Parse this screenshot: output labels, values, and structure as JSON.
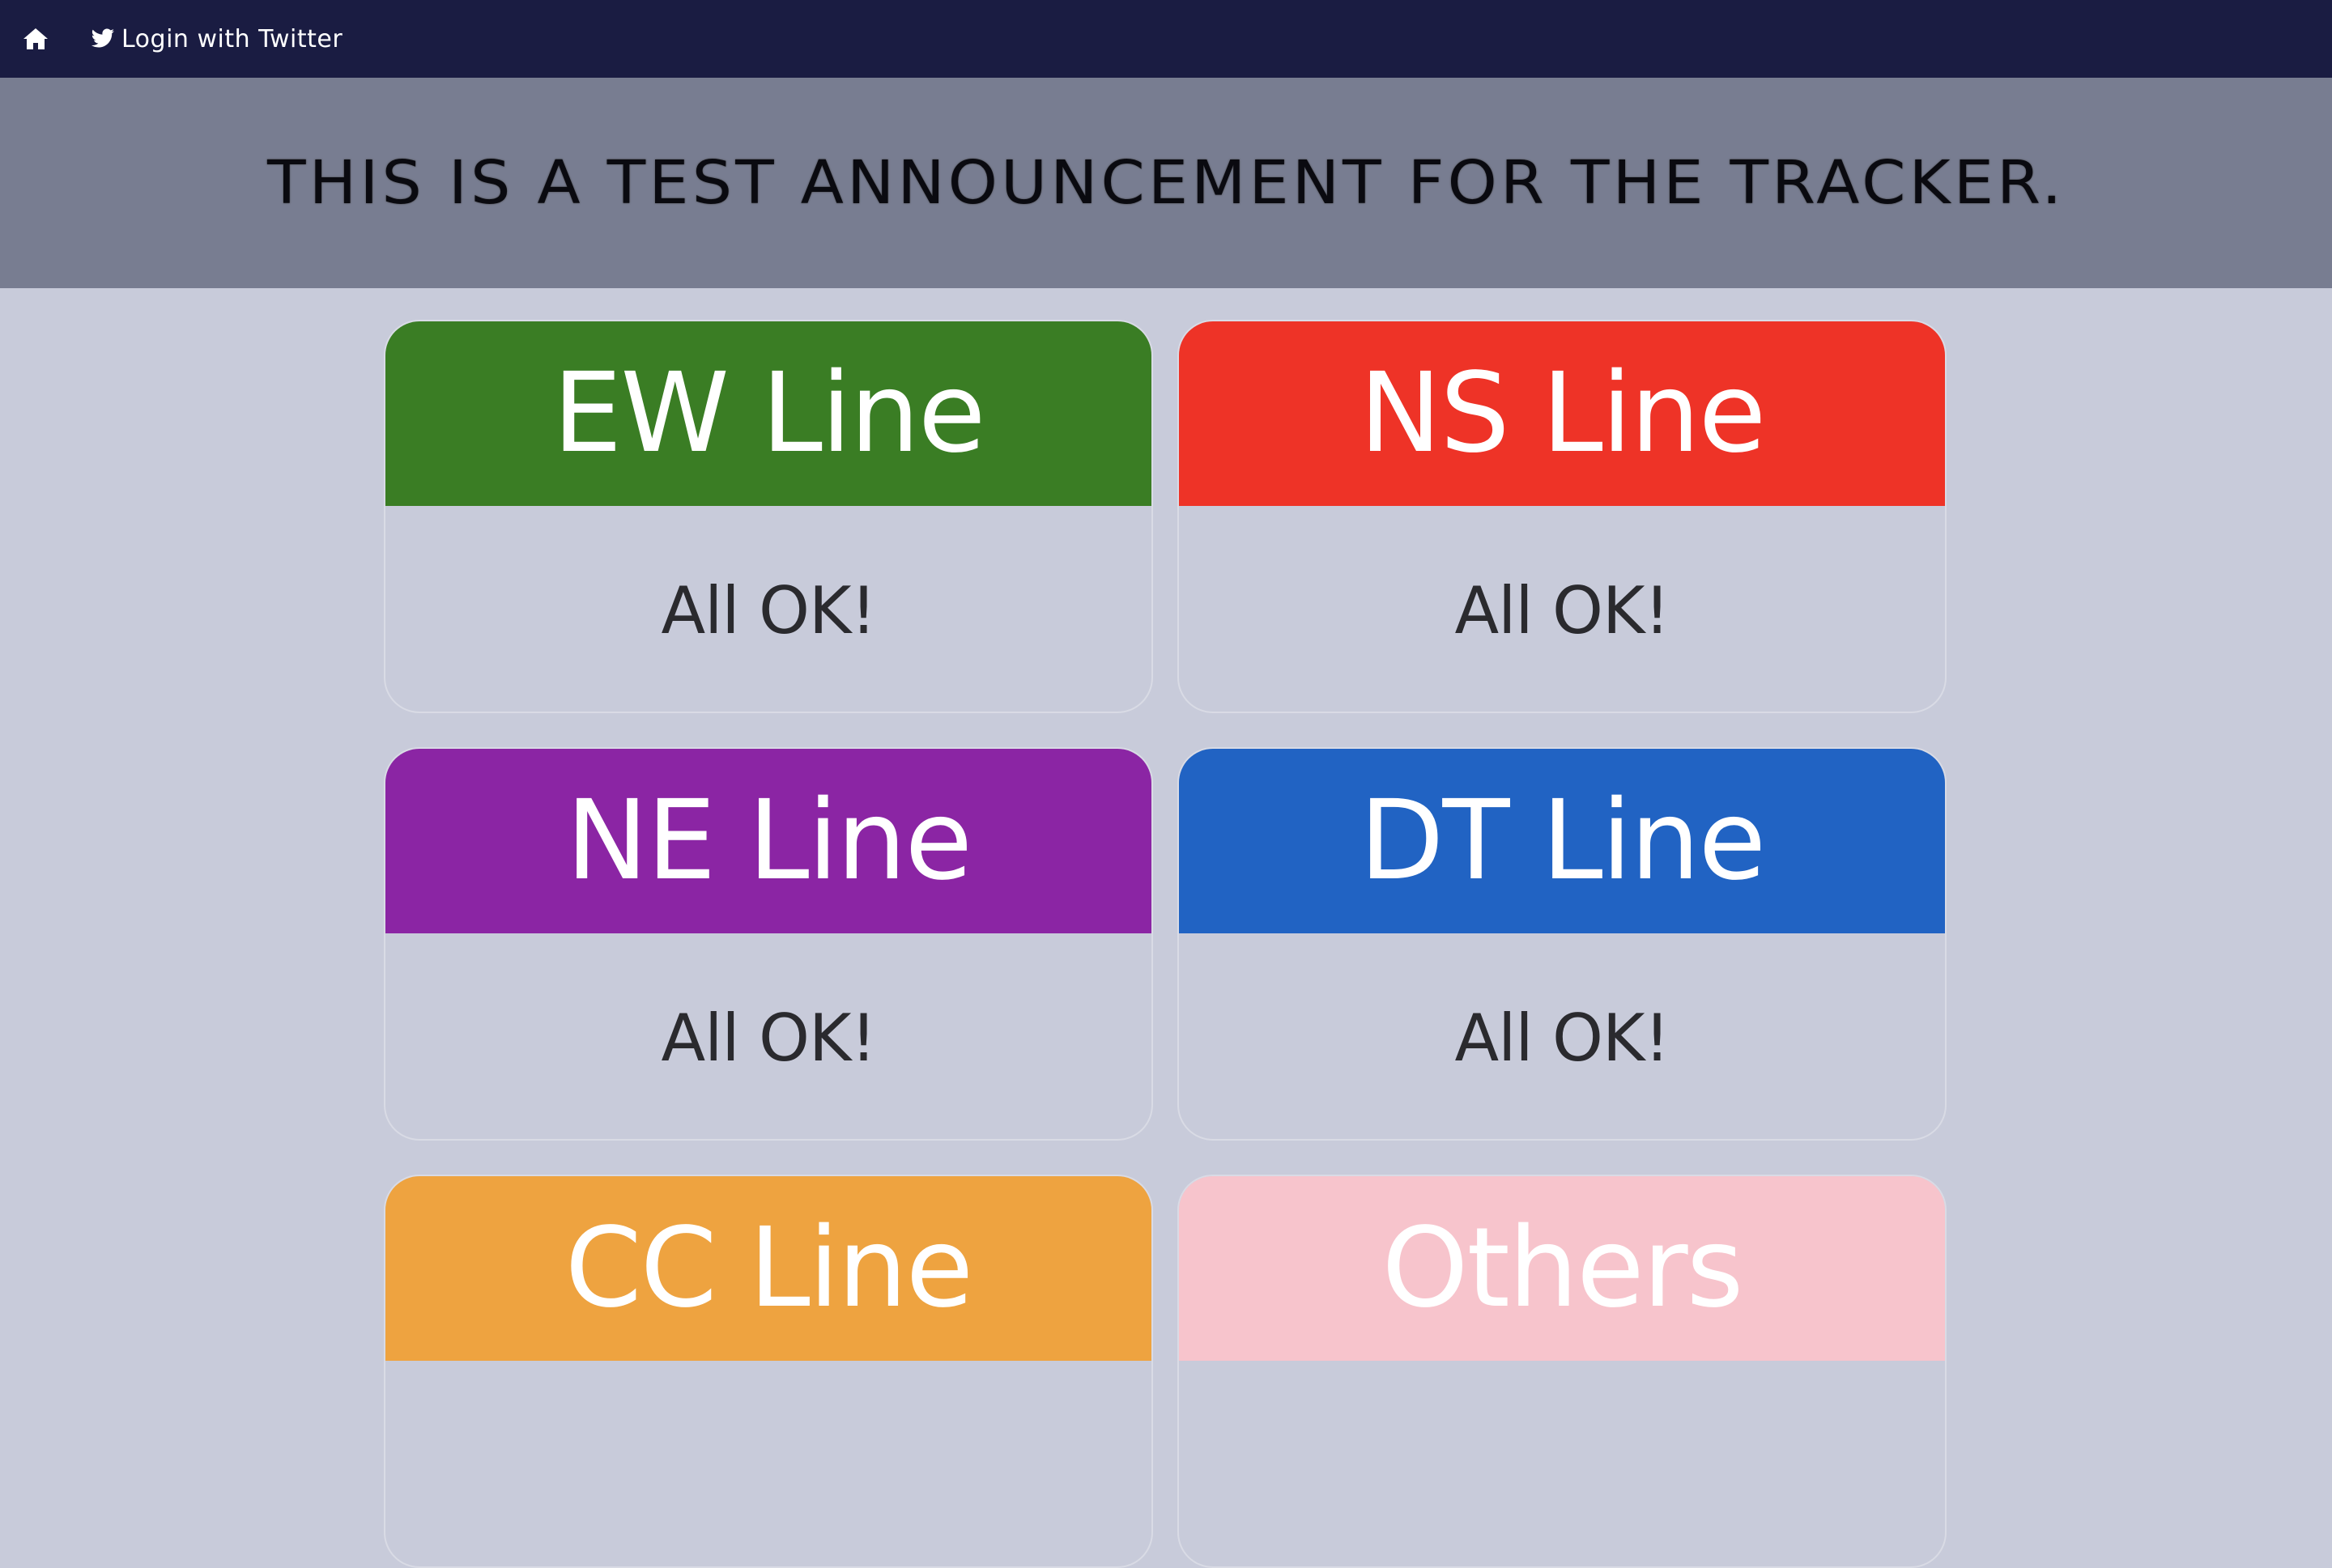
{
  "navbar": {
    "home_icon": "home-icon",
    "login": {
      "icon": "twitter-icon",
      "label": "Login with Twitter"
    }
  },
  "announcement": {
    "text": "THIS IS A TEST ANNOUNCEMENT FOR THE TRACKER."
  },
  "lines": [
    {
      "name": "EW Line",
      "status": "All OK!",
      "color": "#3a7d24"
    },
    {
      "name": "NS Line",
      "status": "All OK!",
      "color": "#ee3327"
    },
    {
      "name": "NE Line",
      "status": "All OK!",
      "color": "#8b25a4"
    },
    {
      "name": "DT Line",
      "status": "All OK!",
      "color": "#2163c3"
    },
    {
      "name": "CC Line",
      "status": "",
      "color": "#eea340"
    },
    {
      "name": "Others",
      "status": "",
      "color": "#f7c4cc"
    }
  ]
}
